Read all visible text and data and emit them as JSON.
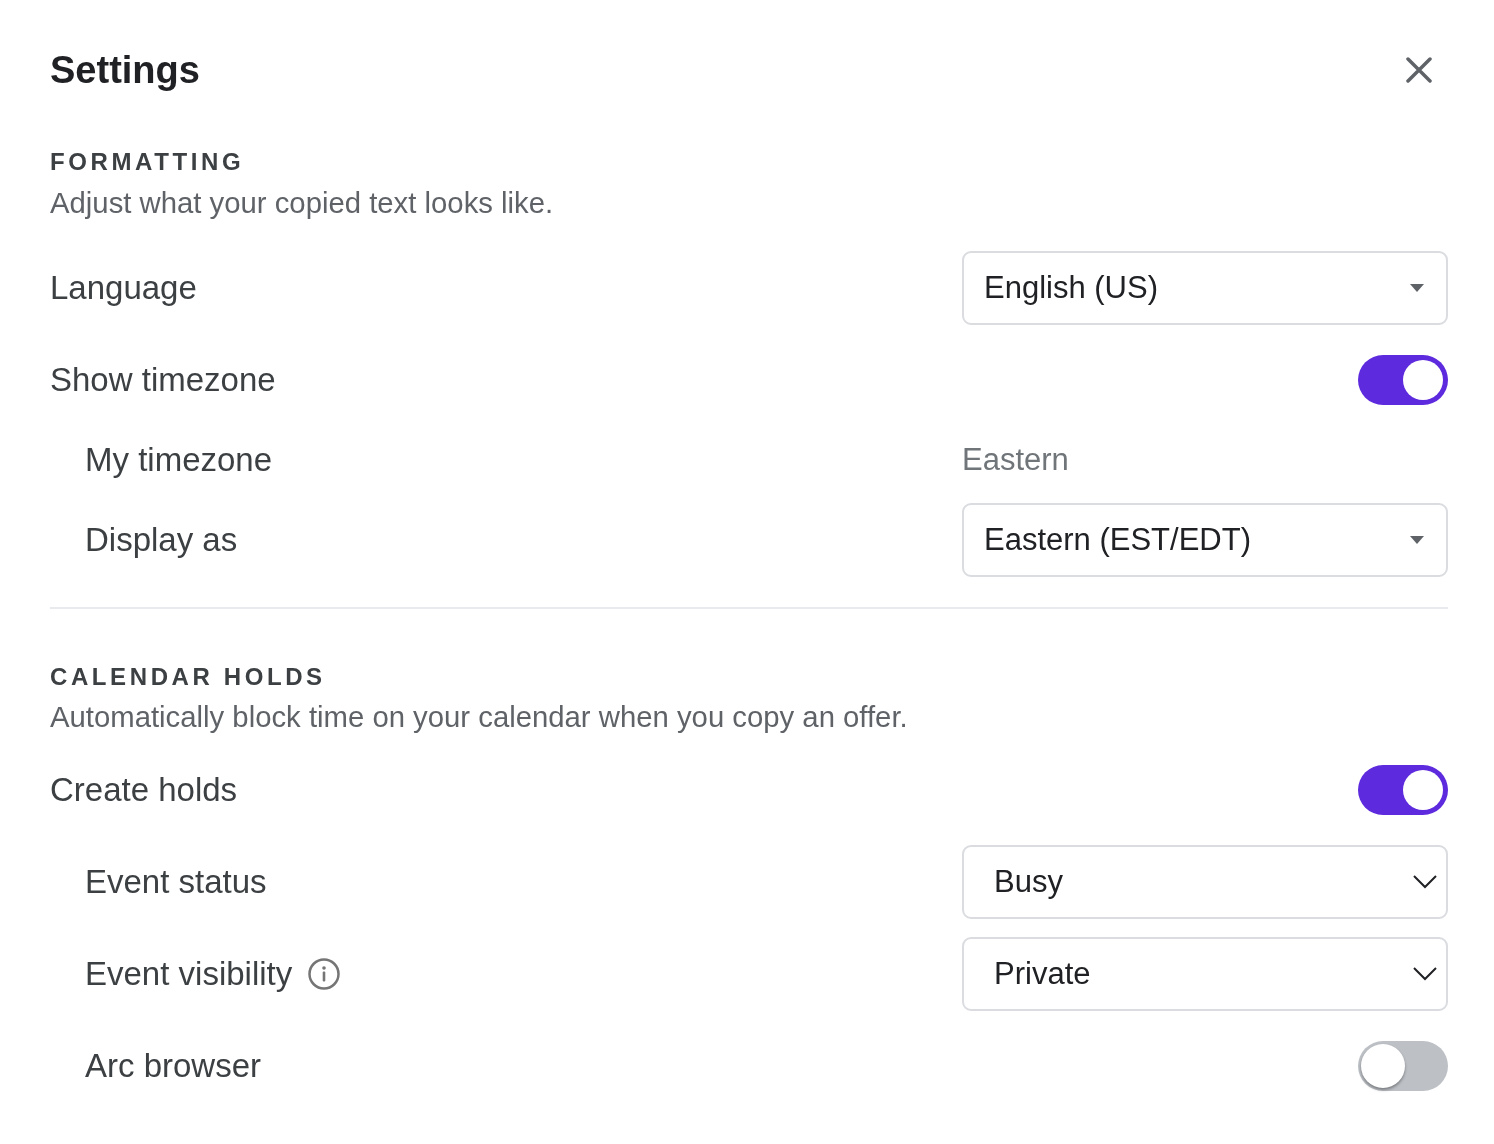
{
  "header": {
    "title": "Settings"
  },
  "sections": [
    {
      "heading": "FORMATTING",
      "description": "Adjust what your copied text looks like.",
      "rows": [
        {
          "kind": "dropdown",
          "label": "Language",
          "value": "English (US)"
        },
        {
          "kind": "toggle",
          "label": "Show timezone",
          "on": true,
          "children": [
            {
              "kind": "text",
              "label": "My timezone",
              "value": "Eastern"
            },
            {
              "kind": "dropdown",
              "label": "Display as",
              "value": "Eastern (EST/EDT)"
            }
          ]
        }
      ]
    },
    {
      "heading": "CALENDAR HOLDS",
      "description": "Automatically block time on your calendar when you copy an offer.",
      "rows": [
        {
          "kind": "toggle",
          "label": "Create holds",
          "on": true,
          "children": [
            {
              "kind": "select",
              "label": "Event status",
              "value": "Busy"
            },
            {
              "kind": "select",
              "label": "Event visibility",
              "value": "Private",
              "info": true
            },
            {
              "kind": "toggle",
              "label": "Arc browser",
              "on": false
            }
          ]
        }
      ]
    }
  ]
}
